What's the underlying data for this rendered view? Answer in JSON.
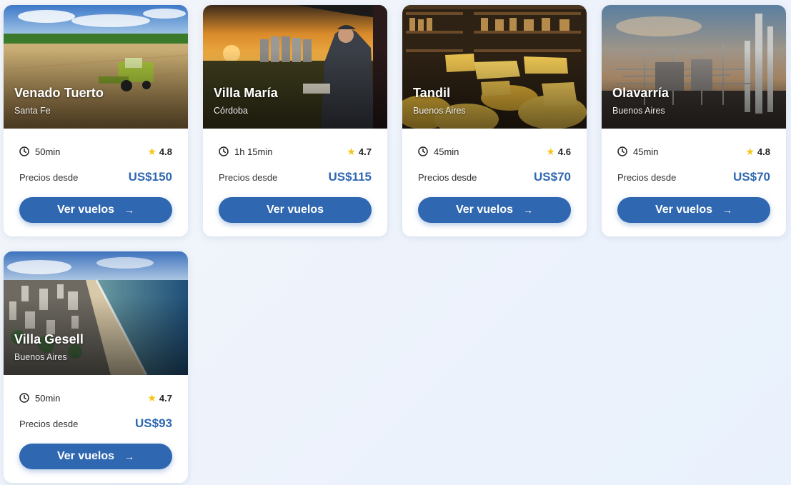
{
  "cards": [
    {
      "city": "Venado Tuerto",
      "province": "Santa Fe",
      "duration": "50min",
      "rating": "4.8",
      "price_label": "Precios desde",
      "price": "US$150",
      "button": "Ver vuelos",
      "has_arrow": true
    },
    {
      "city": "Villa María",
      "province": "Córdoba",
      "duration": "1h 15min",
      "rating": "4.7",
      "price_label": "Precios desde",
      "price": "US$115",
      "button": "Ver vuelos",
      "has_arrow": false
    },
    {
      "city": "Tandil",
      "province": "Buenos Aires",
      "duration": "45min",
      "rating": "4.6",
      "price_label": "Precios desde",
      "price": "US$70",
      "button": "Ver vuelos",
      "has_arrow": true
    },
    {
      "city": "Olavarría",
      "province": "Buenos Aires",
      "duration": "45min",
      "rating": "4.8",
      "price_label": "Precios desde",
      "price": "US$70",
      "button": "Ver vuelos",
      "has_arrow": true
    },
    {
      "city": "Villa Gesell",
      "province": "Buenos Aires",
      "duration": "50min",
      "rating": "4.7",
      "price_label": "Precios desde",
      "price": "US$93",
      "button": "Ver vuelos",
      "has_arrow": true
    }
  ],
  "colors": {
    "accent": "#2f67b1",
    "star": "#f5c518"
  },
  "icons": {
    "duration": "clock-icon",
    "rating": "star-icon",
    "button": "arrow-right-icon"
  }
}
